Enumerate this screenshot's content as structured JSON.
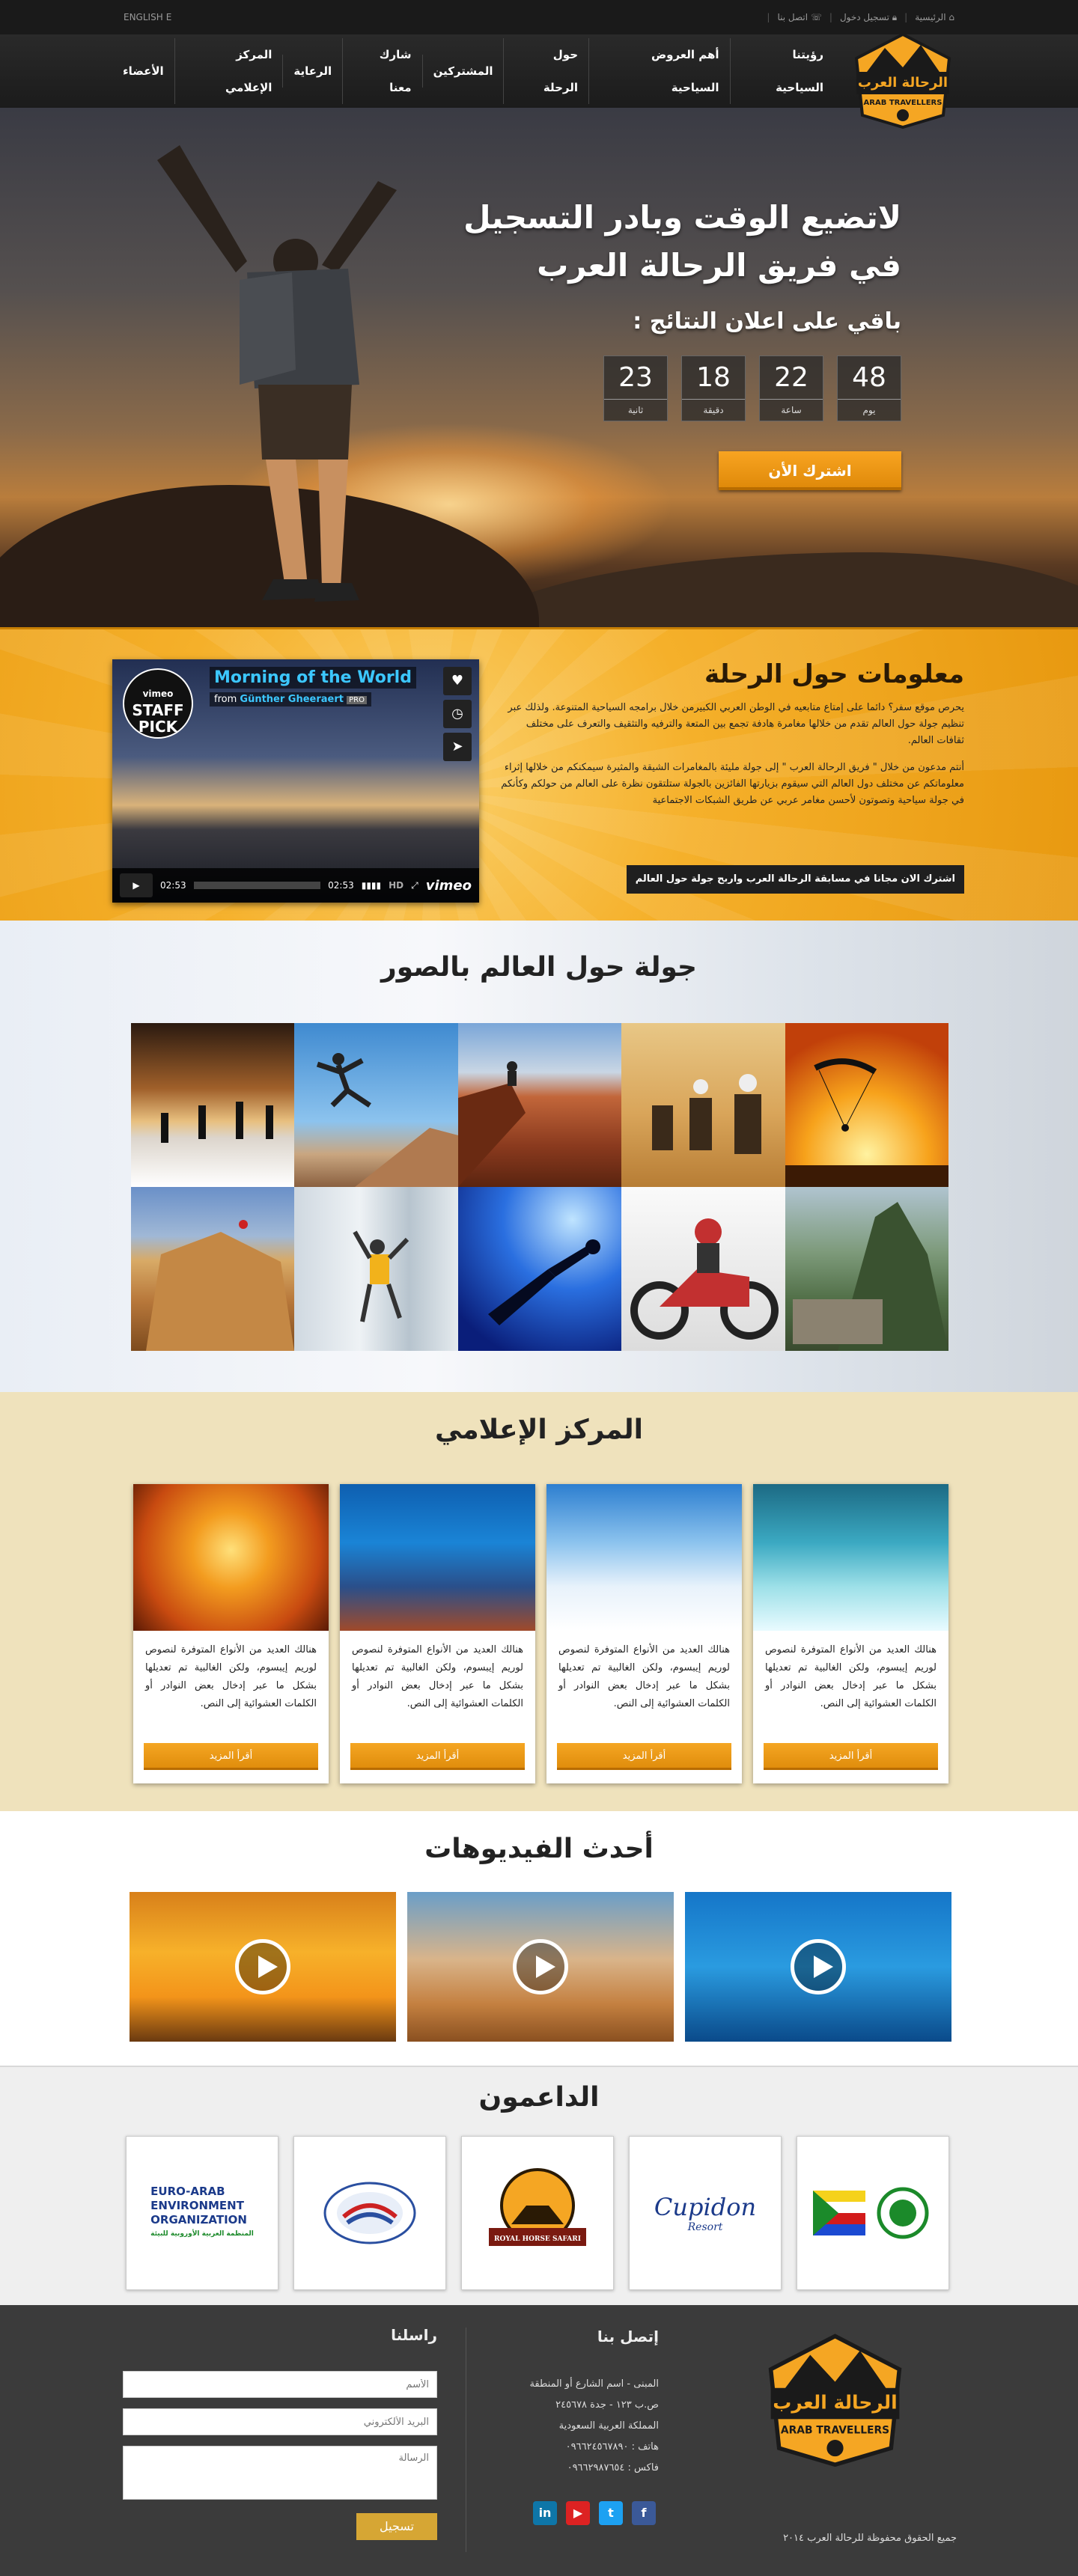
{
  "topbar": {
    "home": "الرئيسية",
    "login": "تسجيل دخول",
    "contact": "اتصل بنا",
    "lang": "ENGLISH"
  },
  "nav": {
    "logo_ar": "الرحالة العرب",
    "logo_en": "ARAB TRAVELLERS",
    "items": [
      "رؤيتنا السياحية",
      "أهم العروض السياحية",
      "حول الرحلة",
      "المشتركين",
      "شارك معنا",
      "الرعاية",
      "المركز الإعلامي",
      "الأعضاء"
    ]
  },
  "hero": {
    "line1": "لاتضيع الوقت وبادر التسجيل",
    "line2": "في فريق الرحالة العرب",
    "subtitle": "باقي على اعلان النتائج :",
    "countdown": [
      {
        "value": "48",
        "unit": "يوم"
      },
      {
        "value": "22",
        "unit": "ساعة"
      },
      {
        "value": "18",
        "unit": "دقيقة"
      },
      {
        "value": "23",
        "unit": "ثانية"
      }
    ],
    "cta": "اشترك الأن"
  },
  "info": {
    "title": "معلومات حول الرحلة",
    "p1": "يحرص موقع سفر؟ دائما على إمتاع متابعيه في الوطن العربي الكبيرمن خلال برامجه السياحية المتنوعة. ولذلك عبر تنظيم جولة حول العالم تقدم من خلالها مغامرة هادفة تجمع بين المتعة والترفيه والتثقيف والتعرف على مختلف ثقافات العالم.",
    "p2": "أنتم مدعون من خلال \" فريق الرحالة العرب \" إلى جولة مليئة بالمغامرات الشيقة والمثيرة سيمكنكم من خلالها إثراء معلوماتكم عن مختلف دول العالم التي سيقوم بزيارتها الفائزين بالجولة ستلتقون نظرة على العالم من حولكم وكأنكم في جولة سياحية وتصوتون لأحسن مغامر عربي عن طريق الشبكات الاجتماعية",
    "button": "اشترك الان مجانا في مسابقة الرحالة العرب واربح جولة حول العالم",
    "video": {
      "title": "Morning of the World",
      "from": "from",
      "author": "Günther Gheeraert",
      "badge": "PRO",
      "staff1": "STAFF",
      "staff2": "PICK",
      "vimeo": "vimeo",
      "time_elapsed": "02:53",
      "time_total": "02:53",
      "hd": "HD",
      "progress": 0
    }
  },
  "gallery": {
    "title": "جولة حول العالم بالصور"
  },
  "media": {
    "title": "المركز الإعلامي",
    "cards": [
      {
        "text": "هنالك العديد من الأنواع المتوفرة لنصوص لوريم إيبسوم، ولكن الغالبية تم تعديلها بشكل ما عبر إدخال بعض النوادر أو الكلمات العشوائية إلى النص.",
        "button": "أقرأ المزيد"
      },
      {
        "text": "هنالك العديد من الأنواع المتوفرة لنصوص لوريم إيبسوم، ولكن الغالبية تم تعديلها بشكل ما عبر إدخال بعض النوادر أو الكلمات العشوائية إلى النص.",
        "button": "أقرأ المزيد"
      },
      {
        "text": "هنالك العديد من الأنواع المتوفرة لنصوص لوريم إيبسوم، ولكن الغالبية تم تعديلها بشكل ما عبر إدخال بعض النوادر أو الكلمات العشوائية إلى النص.",
        "button": "أقرأ المزيد"
      },
      {
        "text": "هنالك العديد من الأنواع المتوفرة لنصوص لوريم إيبسوم، ولكن الغالبية تم تعديلها بشكل ما عبر إدخال بعض النوادر أو الكلمات العشوائية إلى النص.",
        "button": "أقرأ المزيد"
      }
    ]
  },
  "videos": {
    "title": "أحدث الفيديوهات"
  },
  "sponsors": {
    "title": "الداعمون",
    "items": [
      {
        "line1": "EURO-ARAB",
        "line2": "ENVIRONMENT",
        "line3": "ORGANIZATION",
        "line4": "المنظمة العربية الأوروبية للبيئة"
      },
      {
        "line1": ""
      },
      {
        "line1": "ROYAL HORSE SAFARI"
      },
      {
        "line1": "Cupidon",
        "line2": "Resort"
      },
      {
        "line1": ""
      }
    ]
  },
  "footer": {
    "contact_title": "إتصل بنا",
    "address1": "المبنى - اسم الشارع أو المنطقة",
    "address2": "ص.ب ١٢٣ - جدة ٢٤٥٦٧٨",
    "address3": "المملكة العربية السعودية",
    "phone": "هاتف : ٠٩٦٦٢٤٥٦٧٨٩٠",
    "fax": "فاكس : ٠٩٦٦٢٩٨٧٦٥٤",
    "copyright": "جميع الحقوق محفوظة للرحالة العرب ٢٠١٤",
    "form_title": "راسلنا",
    "name_ph": "الأسم",
    "email_ph": "البريد الألكتروني",
    "msg_ph": "الرسالة",
    "send": "تسجيل"
  },
  "colors": {
    "accent": "#f5a623",
    "dark": "#1b1b1b",
    "footer": "#3b3b3b"
  }
}
